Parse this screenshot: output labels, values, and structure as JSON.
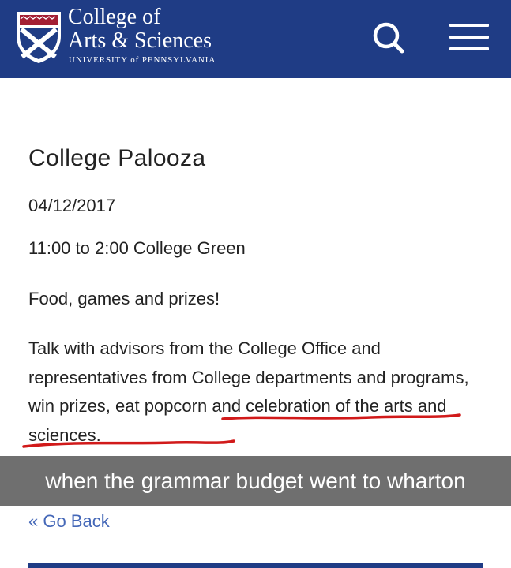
{
  "header": {
    "logo_icon": "penn-shield-icon",
    "brand_line1": "College of",
    "brand_line2": "Arts & Sciences",
    "brand_line3": "UNIVERSITY of PENNSYLVANIA",
    "search_icon": "search-icon",
    "menu_icon": "hamburger-menu-icon",
    "background_color": "#1f3c85"
  },
  "event": {
    "title": "College Palooza",
    "date": "04/12/2017",
    "time_location": "11:00 to 2:00 College Green",
    "summary": "Food, games and prizes!",
    "description": "Talk with advisors from the College Office and representatives from College departments and programs, win prizes, eat popcorn and celebration of the arts and sciences."
  },
  "annotation": {
    "underline_color": "#d11a1a"
  },
  "meme_caption": "when the grammar budget went to wharton",
  "nav": {
    "go_back": "« Go Back",
    "link_color": "#4568b8"
  }
}
